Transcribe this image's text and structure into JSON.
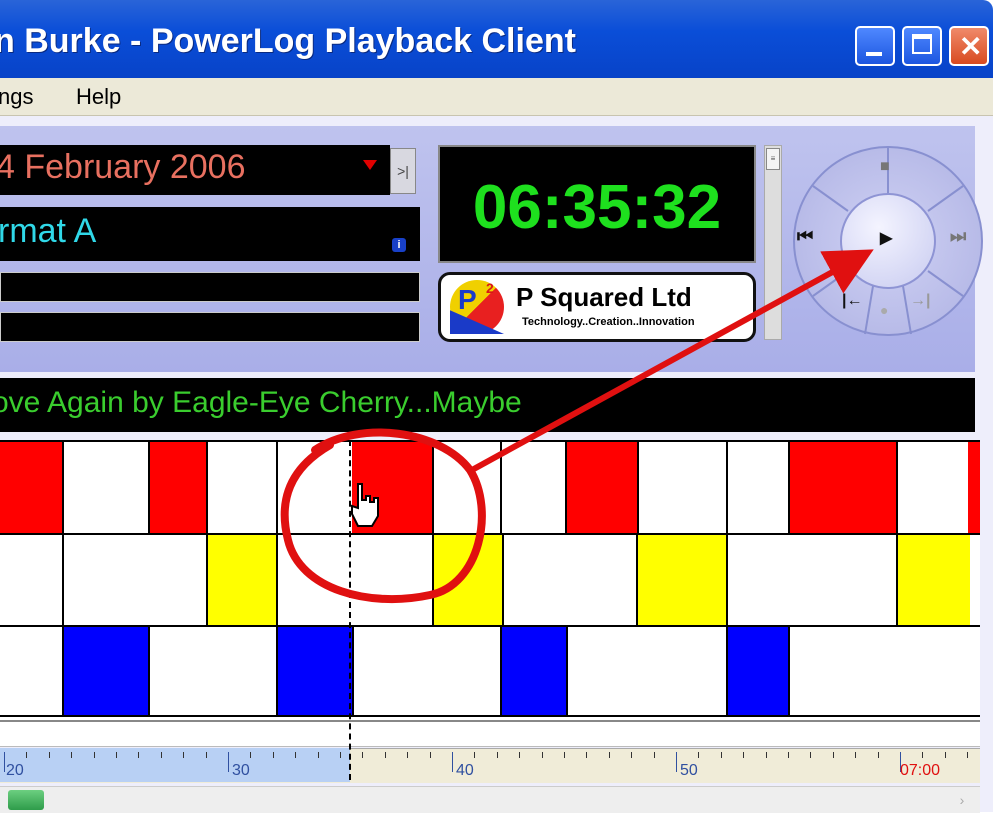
{
  "window": {
    "title": "Burke - PowerLog Playback Client",
    "title_prefix": "n",
    "controls": [
      "minimize",
      "maximize",
      "close"
    ]
  },
  "menu": {
    "items": [
      "ngs",
      "Help"
    ]
  },
  "info": {
    "date": "4 February 2006",
    "format": "rmat A",
    "info_glyph": "i",
    "date_end_glyph": ">|"
  },
  "clock": {
    "time": "06:35:32"
  },
  "logo": {
    "mark_letter": "P",
    "mark_superscript": "2",
    "name": "P Squared Ltd",
    "tagline": "Technology..Creation..Innovation"
  },
  "transport": {
    "stop_glyph": "■",
    "prev_glyph": "⏮",
    "play_glyph": "▶",
    "next_glyph": "⏭",
    "mark_in_glyph": "|←",
    "record_glyph": "●",
    "mark_out_glyph": "→|"
  },
  "now_playing": {
    "text": "ove Again by Eagle-Eye Cherry...Maybe"
  },
  "timeline": {
    "labels": [
      "20",
      "30",
      "40",
      "50",
      "07:00"
    ],
    "highlight_label": "07:00",
    "played_fraction": 0.36
  },
  "colors": {
    "accent_red": "#ff0000",
    "accent_yellow": "#ffff00",
    "accent_blue": "#0000ff",
    "clock_green": "#1ee01e",
    "np_green": "#3acd2e",
    "annotation_red": "#e01010"
  }
}
